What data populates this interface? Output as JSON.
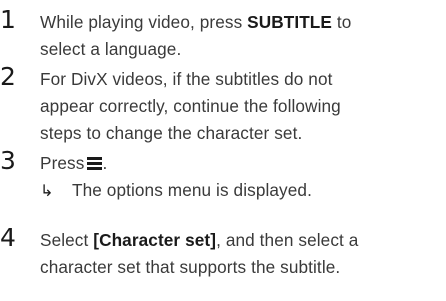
{
  "steps": [
    {
      "number": "1",
      "lines": [
        {
          "pre": "While playing video, press ",
          "bold": "SUBTITLE",
          "post": " to"
        },
        {
          "text": "select a language."
        }
      ]
    },
    {
      "number": "2",
      "lines": [
        {
          "text": "For DivX videos, if the subtitles do not"
        },
        {
          "text": "appear correctly, continue the following"
        },
        {
          "text": "steps to change the character set."
        }
      ]
    },
    {
      "number": "3",
      "press_label": "Press",
      "period": ".",
      "menu_icon": "menu-icon",
      "result_icon": "arrow-icon",
      "result_text": "The options menu is displayed."
    },
    {
      "number": "4",
      "lines": [
        {
          "pre": "Select ",
          "bold": "[Character set]",
          "post": ", and then select a"
        },
        {
          "text": "character set that supports the subtitle."
        }
      ]
    }
  ]
}
